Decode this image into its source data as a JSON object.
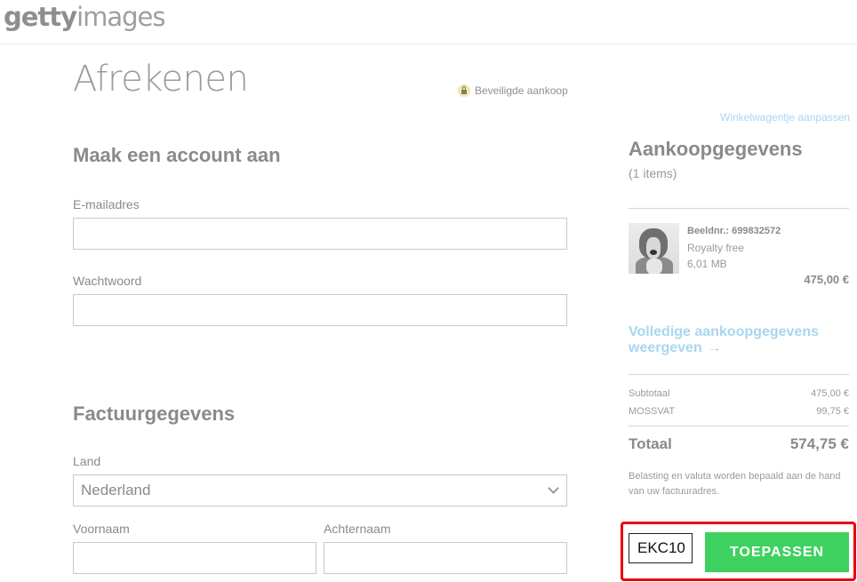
{
  "header": {
    "logo_bold": "getty",
    "logo_light": "images"
  },
  "page": {
    "title": "Afrekenen",
    "secure_label": "Beveiligde aankoop"
  },
  "account": {
    "heading": "Maak een account aan",
    "email_label": "E-mailadres",
    "email_value": "",
    "password_label": "Wachtwoord",
    "password_value": ""
  },
  "billing": {
    "heading": "Factuurgegevens",
    "country_label": "Land",
    "country_value": "Nederland",
    "first_name_label": "Voornaam",
    "last_name_label": "Achternaam"
  },
  "summary": {
    "edit_cart_link": "Winkelwagentje aanpassen",
    "heading": "Aankoopgegevens",
    "count": "(1 items)",
    "item": {
      "id_label": "Beeldnr.: 699832572",
      "license": "Royalty free",
      "size": "6,01 MB",
      "price": "475,00 €"
    },
    "full_details_link": "Volledige aankoopgegevens weergeven",
    "subtotal_label": "Subtotaal",
    "subtotal_value": "475,00 €",
    "vat_label": "MOSSVAT",
    "vat_value": "99,75 €",
    "total_label": "Totaal",
    "total_value": "574,75 €",
    "note": "Belasting en valuta worden bepaald aan de hand van uw factuuradres."
  },
  "promo": {
    "code_value": "EKC10",
    "apply_label": "TOEPASSEN",
    "highlight_color": "#e8000b",
    "button_color": "#3fd160"
  },
  "icons": {
    "secure": "lock-icon",
    "dropdown": "chevron-down-icon",
    "link_arrow": "arrow-right-icon"
  }
}
